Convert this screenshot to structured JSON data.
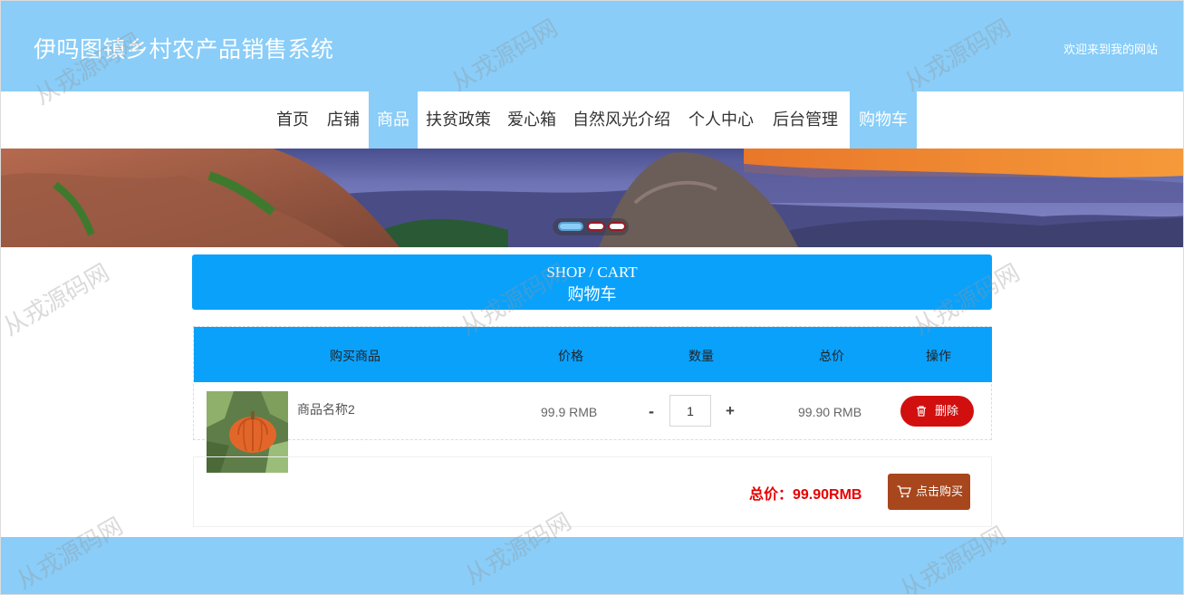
{
  "header": {
    "title": "伊吗图镇乡村农产品销售系统",
    "welcome": "欢迎来到我的网站"
  },
  "nav": {
    "items": [
      {
        "label": "首页"
      },
      {
        "label": "店铺"
      },
      {
        "label": "商品"
      },
      {
        "label": "扶贫政策"
      },
      {
        "label": "爱心箱"
      },
      {
        "label": "自然风光介绍"
      },
      {
        "label": "个人中心"
      },
      {
        "label": "后台管理"
      },
      {
        "label": "购物车"
      }
    ],
    "highlighted": [
      "商品",
      "购物车"
    ]
  },
  "banner": {
    "slide_count": 3,
    "active_slide": 1
  },
  "section": {
    "title_en": "SHOP / CART",
    "title_cn": "购物车"
  },
  "cart": {
    "columns": [
      "购买商品",
      "价格",
      "数量",
      "总价",
      "操作"
    ],
    "rows": [
      {
        "name": "商品名称2",
        "price": "99.9 RMB",
        "quantity": "1",
        "minus": "-",
        "plus": "+",
        "subtotal": "99.90 RMB",
        "delete_label": "删除"
      }
    ]
  },
  "summary": {
    "total": "总价：99.90RMB",
    "buy_label": "点击购买"
  },
  "watermark": "从戎源码网",
  "colors": {
    "header": "#89cdf8",
    "accent": "#0aa1fb",
    "delete": "#d20f0f",
    "buy": "#a8461d",
    "total": "#e60000"
  }
}
